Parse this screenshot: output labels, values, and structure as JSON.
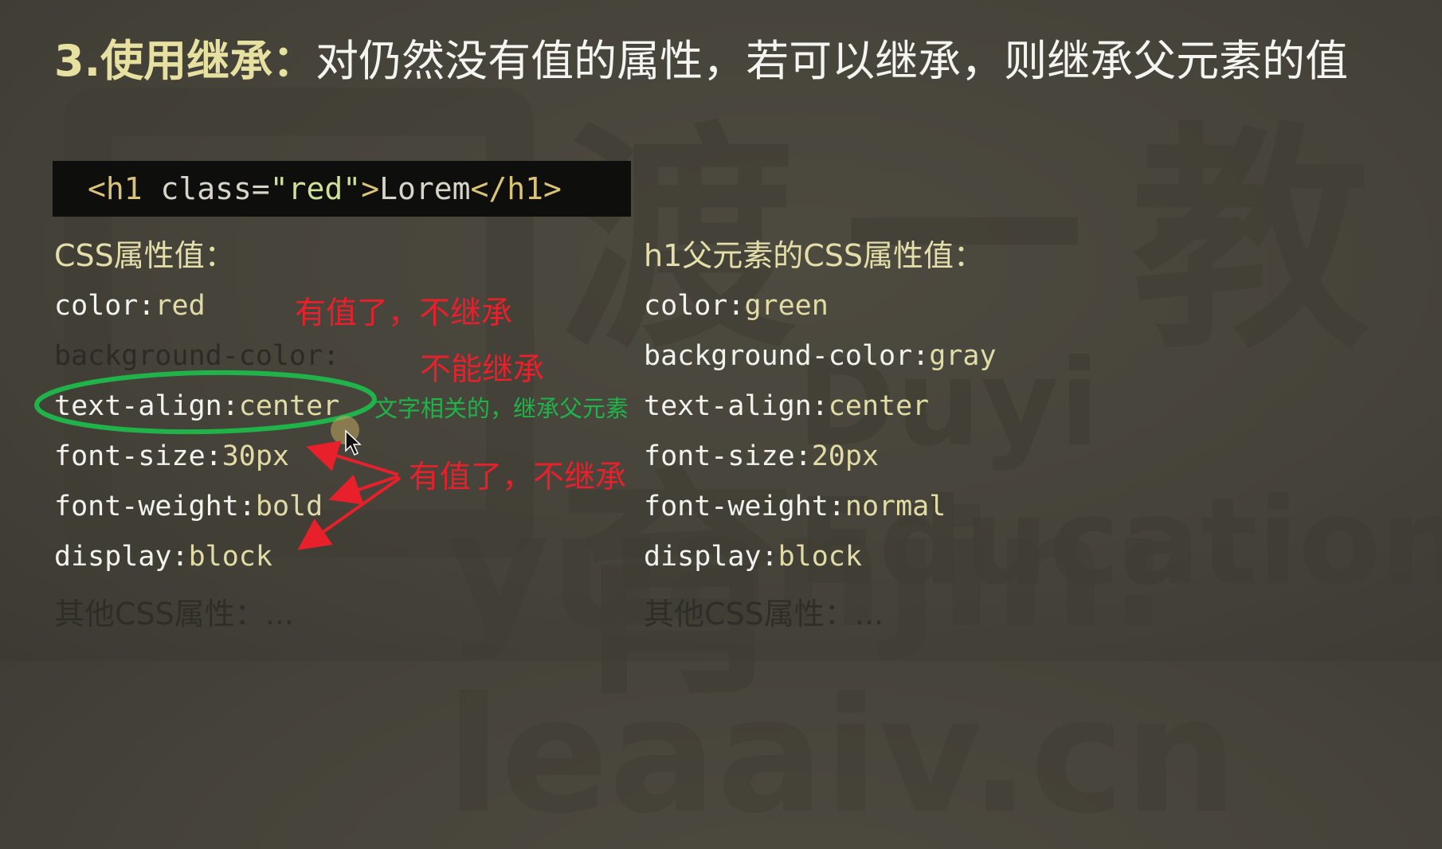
{
  "slide": {
    "title_number": "3.",
    "title_head": "使用继承：",
    "title_body": "对仍然没有值的属性，若可以继承，则继承父元素的值"
  },
  "code": {
    "open_tag": "<h1 ",
    "attr_name": "class=",
    "attr_value": "\"red\"",
    "tag_close": ">",
    "text": "Lorem",
    "end_tag": "</h1>"
  },
  "left_column": {
    "heading": "CSS属性值：",
    "properties": [
      {
        "name": "color:",
        "value": "red"
      },
      {
        "name": "background-color:",
        "value": ""
      },
      {
        "name": "text-align:",
        "value": "center"
      },
      {
        "name": "font-size:",
        "value": "30px"
      },
      {
        "name": "font-weight:",
        "value": "bold"
      },
      {
        "name": "display:",
        "value": "block"
      }
    ],
    "other": "其他CSS属性：..."
  },
  "right_column": {
    "heading": "h1父元素的CSS属性值：",
    "properties": [
      {
        "name": "color:",
        "value": "green"
      },
      {
        "name": "background-color:",
        "value": "gray"
      },
      {
        "name": "text-align:",
        "value": "center"
      },
      {
        "name": "font-size:",
        "value": "20px"
      },
      {
        "name": "font-weight:",
        "value": "normal"
      },
      {
        "name": "display:",
        "value": "block"
      }
    ],
    "other": "其他CSS属性：..."
  },
  "annotations": {
    "red_note_1": "有值了，不继承",
    "red_note_2": "不能继承",
    "green_note": "文字相关的，继承父元素",
    "red_note_3": "有值了，不继承"
  },
  "watermark": {
    "chinese": "渡一教育",
    "english_1": "Duyi Education",
    "english_2": "yuanjin: leaaiv.cn"
  },
  "colors": {
    "background": "#46433a",
    "title_accent": "#e6e0a1",
    "annotation_red": "#e8202b",
    "annotation_green": "#1fb34a",
    "code_background": "#0e0e0c"
  }
}
